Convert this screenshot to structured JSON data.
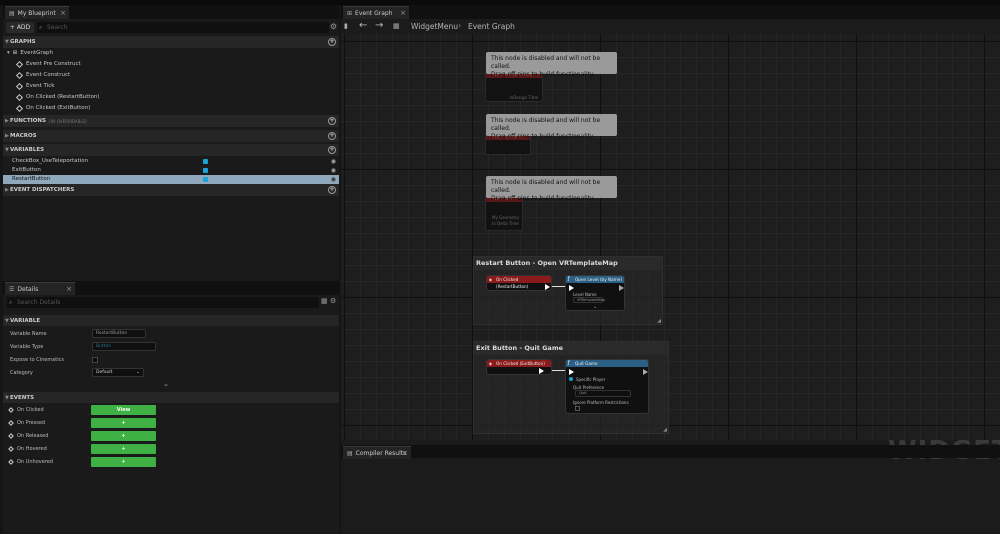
{
  "blueprint_panel": {
    "tab_label": "My Blueprint",
    "add_label": "ADD",
    "search_placeholder": "Search",
    "sections": {
      "graphs": "GRAPHS",
      "functions": "FUNCTIONS",
      "functions_sub": "(90 OVERRIDABLE)",
      "macros": "MACROS",
      "variables": "VARIABLES",
      "dispatchers": "EVENT DISPATCHERS"
    },
    "graph_root": "EventGraph",
    "graph_items": [
      "Event Pre Construct",
      "Event Construct",
      "Event Tick",
      "On Clicked (RestartButton)",
      "On Clicked (ExitButton)"
    ],
    "variables": [
      "CheckBox_UseTeleportation",
      "ExitButton",
      "RestartButton"
    ]
  },
  "details_panel": {
    "tab_label": "Details",
    "search_placeholder": "Search Details",
    "variable_header": "VARIABLE",
    "rows": {
      "name_label": "Variable Name",
      "name_value": "RestartButton",
      "type_label": "Variable Type",
      "type_value": "Button",
      "expose_label": "Expose to Cinematics",
      "category_label": "Category",
      "category_value": "Default"
    },
    "events_header": "EVENTS",
    "events": [
      "On Clicked",
      "On Pressed",
      "On Released",
      "On Hovered",
      "On Unhovered"
    ],
    "on_clicked_value": "View"
  },
  "graph_panel": {
    "tab_label": "Event Graph",
    "breadcrumb_root": "WidgetMenu",
    "breadcrumb_sep": "›",
    "breadcrumb_leaf": "Event Graph",
    "disabled_text_1": "This node is disabled and will not be called.",
    "disabled_text_2": "Drag off pins to build functionality.",
    "disabled_nodes": [
      {
        "title": "Event Pre Construct",
        "sub": "IsDesign Time"
      },
      {
        "title": "Event Construct",
        "sub": ""
      },
      {
        "title": "Event Tick",
        "sub": "My Geometry  In Delta Time"
      }
    ],
    "comment_restart": "Restart Button - Open VRTemplateMap",
    "comment_exit": "Exit Button - Quit Game",
    "restart_event": "On Clicked (RestartButton)",
    "open_level": "Open Level (by Name)",
    "level_name_label": "Level Name",
    "level_name_value": "VRTemplateMap",
    "exit_event": "On Clicked (ExitButton)",
    "quit_game": "Quit Game",
    "specific_player": "Specific Player",
    "quit_preference_label": "Quit Preference",
    "quit_preference_value": "Quit",
    "ignore_platform": "Ignore Platform Restrictions",
    "watermark": "WIDGET B",
    "compiler_tab": "Compiler Results"
  },
  "colors": {
    "event_header": "#8b1a1a",
    "function_header": "#2b5f86",
    "event_button": "#3fb043",
    "variable_pill": "#1aa3d6",
    "selected_row": "#8fa8bb"
  }
}
